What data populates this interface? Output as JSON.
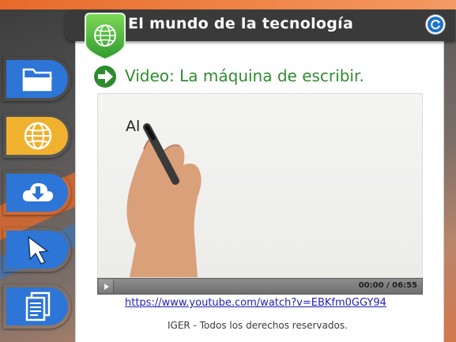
{
  "app": {
    "title": "El mundo de la tecnología",
    "logo_icon": "globe-icon",
    "reload_icon": "refresh-icon"
  },
  "sidebar": {
    "items": [
      {
        "icon": "folder-icon",
        "active": false
      },
      {
        "icon": "globe-icon",
        "active": true
      },
      {
        "icon": "cloud-download-icon",
        "active": false
      },
      {
        "icon": "cursor-arrow-icon",
        "active": false
      },
      {
        "icon": "documents-icon",
        "active": false
      }
    ]
  },
  "content": {
    "heading": "Video: La máquina de escribir.",
    "heading_icon": "arrow-right-circle-icon",
    "video": {
      "frame_text": "Al",
      "time": "00:00 / 06:55",
      "progress": 0.0
    },
    "link": "https://www.youtube.com/watch?v=EBKfm0GGY94",
    "footer": "IGER - Todos los derechos reservados."
  },
  "colors": {
    "accent_blue": "#2d75d7",
    "active_yellow": "#f0b12e",
    "heading_green": "#2e8b2e",
    "header_dark": "#3a3a3a"
  }
}
